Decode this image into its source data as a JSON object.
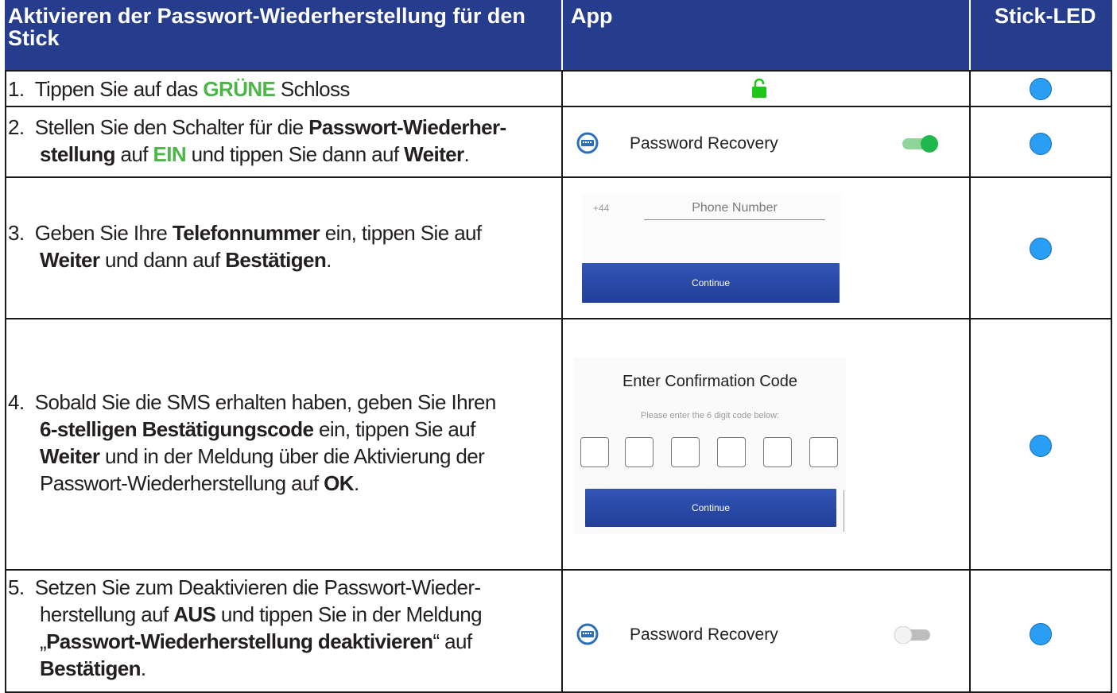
{
  "header": {
    "col1_line1": "Aktivieren der Passwort-Wiederherstellung für den",
    "col1_line2": "Stick",
    "col2": "App",
    "col3": "Stick-LED"
  },
  "rows": [
    {
      "num": "1.",
      "parts": [
        "Tippen Sie auf das ",
        "GRÜNE",
        " Schloss"
      ]
    },
    {
      "num": "2.",
      "line1": [
        "Stellen Sie den Schalter für die ",
        "Passwort-Wiederher-"
      ],
      "line2": [
        "stellung",
        " auf ",
        "EIN",
        " und tippen Sie dann auf ",
        "Weiter",
        "."
      ],
      "app_label": "Password Recovery"
    },
    {
      "num": "3.",
      "line1": [
        "Geben Sie Ihre ",
        "Telefonnummer",
        " ein, tippen Sie auf"
      ],
      "line2": [
        "Weiter",
        " und dann auf ",
        "Bestätigen",
        "."
      ],
      "country_code": "+44",
      "phone_placeholder": "Phone Number",
      "continue_label": "Continue"
    },
    {
      "num": "4.",
      "line1": [
        "Sobald Sie die SMS erhalten haben, geben Sie Ihren"
      ],
      "line2": [
        "6-stelligen Bestätigungscode",
        " ein, tippen Sie auf"
      ],
      "line3": [
        "Weiter",
        " und in der Meldung über die Aktivierung der"
      ],
      "line4": [
        "Passwort-Wiederherstellung auf ",
        "OK",
        "."
      ],
      "code_title": "Enter Confirmation Code",
      "code_hint": "Please enter the 6 digit code below:",
      "continue_label": "Continue"
    },
    {
      "num": "5.",
      "line1": [
        "Setzen Sie zum Deaktivieren die Passwort-Wieder-"
      ],
      "line2": [
        "herstellung auf ",
        "AUS",
        " und tippen Sie in der Meldung"
      ],
      "line3": [
        "„",
        "Passwort-Wiederherstellung deaktivieren",
        "“ auf"
      ],
      "line4": [
        "Bestätigen",
        "."
      ],
      "app_label": "Password Recovery"
    }
  ],
  "colors": {
    "header_bg": "#263d8e",
    "green": "#4cb748",
    "led_blue": "#2a9df4",
    "button_blue": "#2b4aa8"
  },
  "states": {
    "row2_toggle": "on",
    "row5_toggle": "off",
    "lock": "unlocked-green"
  }
}
